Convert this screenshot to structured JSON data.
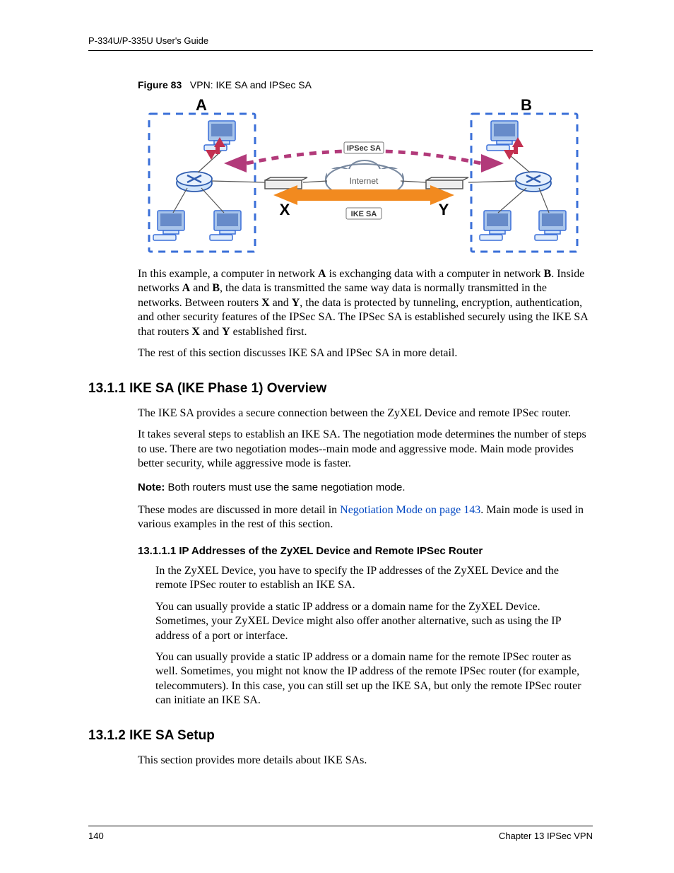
{
  "header": {
    "guide_title": "P-334U/P-335U User's Guide"
  },
  "footer": {
    "page_number": "140",
    "chapter": "Chapter 13 IPSec VPN"
  },
  "figure": {
    "label": "Figure 83",
    "title": "VPN: IKE SA and IPSec SA",
    "labels": {
      "A": "A",
      "B": "B",
      "X": "X",
      "Y": "Y",
      "ipsec_sa": "IPSec SA",
      "ike_sa": "IKE SA",
      "internet": "Internet"
    }
  },
  "paragraphs": {
    "p1_a": "In this example, a computer in network ",
    "p1_A": "A",
    "p1_b": " is exchanging data with a computer in network ",
    "p1_B": "B",
    "p1_c": ". Inside networks ",
    "p1_A2": "A",
    "p1_d": " and ",
    "p1_B2": "B",
    "p1_e": ", the data is transmitted the same way data is normally transmitted in the networks. Between routers ",
    "p1_X": "X",
    "p1_f": " and ",
    "p1_Y": "Y",
    "p1_g": ", the data is protected by tunneling, encryption, authentication, and other security features of the IPSec SA. The IPSec SA is established securely using the IKE SA that routers ",
    "p1_X2": "X",
    "p1_h": " and ",
    "p1_Y2": "Y",
    "p1_i": " established first.",
    "p2": "The rest of this section discusses IKE SA and IPSec SA in more detail."
  },
  "sections": {
    "s1": {
      "heading": "13.1.1  IKE SA (IKE Phase 1) Overview",
      "p1": "The IKE SA provides a secure connection between the ZyXEL Device and remote IPSec router.",
      "p2": "It takes several steps to establish an IKE SA. The negotiation mode determines the number of steps to use. There are two negotiation modes--main mode and aggressive mode. Main mode provides better security, while aggressive mode is faster.",
      "note_label": "Note:",
      "note_text": " Both routers must use the same negotiation mode.",
      "p3_a": "These modes are discussed in more detail in ",
      "p3_link": "Negotiation Mode on page 143",
      "p3_b": ". Main mode is used in various examples in the rest of this section."
    },
    "s1_1": {
      "heading": "13.1.1.1  IP Addresses of the ZyXEL Device and Remote IPSec Router",
      "p1": "In the ZyXEL Device, you have to specify the IP addresses of the ZyXEL Device and the remote IPSec router to establish an IKE SA.",
      "p2": "You can usually provide a static IP address or a domain name for the ZyXEL Device. Sometimes, your ZyXEL Device might also offer another alternative, such as using the IP address of a port or interface.",
      "p3": "You can usually provide a static IP address or a domain name for the remote IPSec router as well. Sometimes, you might not know the IP address of the remote IPSec router (for example, telecommuters). In this case, you can still set up the IKE SA, but only the remote IPSec router can initiate an IKE SA."
    },
    "s2": {
      "heading": "13.1.2  IKE SA Setup",
      "p1": "This section provides more details about IKE SAs."
    }
  }
}
